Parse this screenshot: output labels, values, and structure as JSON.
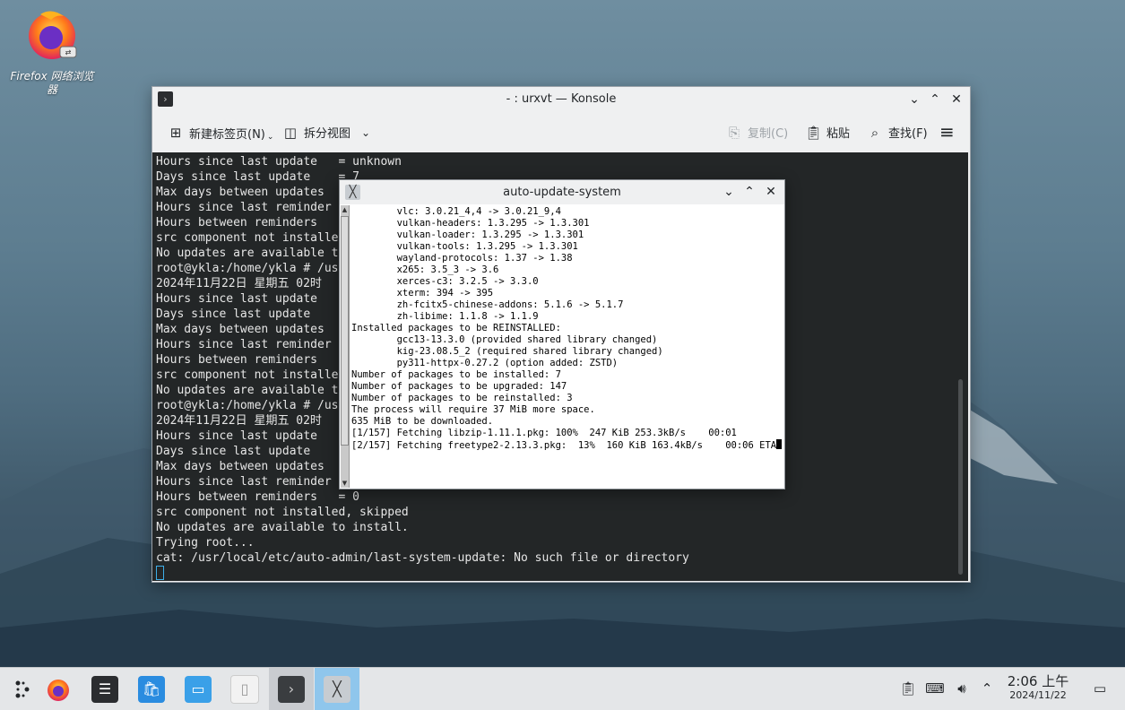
{
  "desktop": {
    "icon_label": "Firefox 网络浏览器"
  },
  "konsole": {
    "title": "- : urxvt — Konsole",
    "toolbar": {
      "new_tab": "新建标签页(N)",
      "split_view": "拆分视图",
      "copy": "复制(C)",
      "paste": "粘贴",
      "find": "查找(F)"
    },
    "lines": [
      "Hours since last update   = unknown",
      "Days since last update    = 7",
      "Max days between updates ",
      "Hours since last reminder",
      "Hours between reminders  ",
      "src component not installe",
      "No updates are available t",
      "root@ykla:/home/ykla # /us",
      "2024年11月22日 星期五 02时",
      "Hours since last update  ",
      "Days since last update   ",
      "Max days between updates ",
      "Hours since last reminder",
      "Hours between reminders  ",
      "src component not installe",
      "No updates are available t",
      "root@ykla:/home/ykla # /us",
      "2024年11月22日 星期五 02时",
      "Hours since last update  ",
      "Days since last update   ",
      "Max days between updates ",
      "Hours since last reminder",
      "Hours between reminders   = 0",
      "src component not installed, skipped",
      "No updates are available to install.",
      "Trying root...",
      "cat: /usr/local/etc/auto-admin/last-system-update: No such file or directory"
    ]
  },
  "urxvt": {
    "title": "auto-update-system",
    "lines": [
      "        vlc: 3.0.21_4,4 -> 3.0.21_9,4",
      "        vulkan-headers: 1.3.295 -> 1.3.301",
      "        vulkan-loader: 1.3.295 -> 1.3.301",
      "        vulkan-tools: 1.3.295 -> 1.3.301",
      "        wayland-protocols: 1.37 -> 1.38",
      "        x265: 3.5_3 -> 3.6",
      "        xerces-c3: 3.2.5 -> 3.3.0",
      "        xterm: 394 -> 395",
      "        zh-fcitx5-chinese-addons: 5.1.6 -> 5.1.7",
      "        zh-libime: 1.1.8 -> 1.1.9",
      "",
      "Installed packages to be REINSTALLED:",
      "        gcc13-13.3.0 (provided shared library changed)",
      "        kig-23.08.5_2 (required shared library changed)",
      "        py311-httpx-0.27.2 (option added: ZSTD)",
      "",
      "Number of packages to be installed: 7",
      "Number of packages to be upgraded: 147",
      "Number of packages to be reinstalled: 3",
      "",
      "The process will require 37 MiB more space.",
      "635 MiB to be downloaded.",
      "[1/157] Fetching libzip-1.11.1.pkg: 100%  247 KiB 253.3kB/s    00:01",
      "[2/157] Fetching freetype2-2.13.3.pkg:  13%  160 KiB 163.4kB/s    00:06 ETA"
    ]
  },
  "taskbar": {
    "time": "2:06 上午",
    "date": "2024/11/22"
  }
}
